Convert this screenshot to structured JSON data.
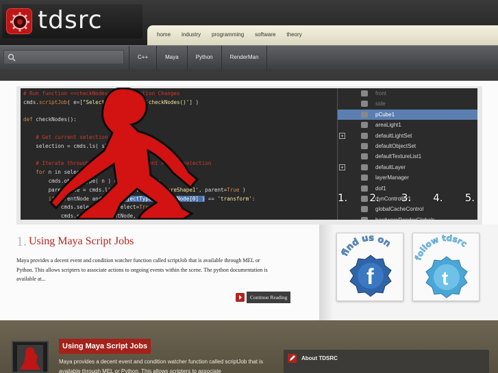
{
  "brand": {
    "name": "tdsrc"
  },
  "topnav": [
    "home",
    "industry",
    "programming",
    "software",
    "theory"
  ],
  "search": {
    "placeholder": ""
  },
  "subnav": [
    "C++",
    "Maya",
    "Python",
    "RenderMan"
  ],
  "code_lines": [
    {
      "c": "# Run function <<checkNodes>> on Selection Changes"
    },
    {
      "t": "cmds.",
      "k": "scriptJob",
      "t2": "( e=[",
      "s": "\"SelectionChanged\", 'checkNodes()'",
      "t3": "] )"
    },
    {
      "t": ""
    },
    {
      "k": "def",
      "t": " checkNodes():"
    },
    {
      "t": ""
    },
    {
      "c": "    # Get current selection"
    },
    {
      "t": "    selection = cmds.ls( sl=True )"
    },
    {
      "t": ""
    },
    {
      "c": "    # Iterate through selection, get parent > swap selection"
    },
    {
      "k": "    for",
      "t": " n in selection:"
    },
    {
      "t": "        cmds.objectType( n ) == ",
      "s": "'transform'",
      "t2": ":"
    },
    {
      "t": "        parentNode = cmds.listRelatives( ",
      "s": "'pSphereShape1'",
      "t2": ", parent=",
      "k": "True",
      "t3": " )"
    },
    {
      "k": "        if",
      "t": " parentNode and cmds.",
      "h": "objectType( parentNode[0] )",
      "t2": " == ",
      "s": "'transform'",
      "t3": ":"
    },
    {
      "t": "            cmds.select( n, deselect=",
      "k": "True",
      "t2": " )"
    },
    {
      "t": "            cmds.select( parentNode, add=",
      "k": "True",
      "t2": " )"
    }
  ],
  "outliner": [
    {
      "label": "front",
      "state": "dim"
    },
    {
      "label": "side",
      "state": "dim"
    },
    {
      "label": "pCube1",
      "state": "sel"
    },
    {
      "label": "areaLight1",
      "state": ""
    },
    {
      "label": "defaultLightSet",
      "state": "",
      "expand": true
    },
    {
      "label": "defaultObjectSet",
      "state": ""
    },
    {
      "label": "defaultTextureList1",
      "state": ""
    },
    {
      "label": "defaultLayer",
      "state": "",
      "expand": true
    },
    {
      "label": "layerManager",
      "state": ""
    },
    {
      "label": "dof1",
      "state": ""
    },
    {
      "label": "dynController1",
      "state": ""
    },
    {
      "label": "globalCacheControl",
      "state": ""
    },
    {
      "label": "hardwareRenderGlobals",
      "state": ""
    }
  ],
  "slide_numbers": [
    "1.",
    "2.",
    "3.",
    "4.",
    "5."
  ],
  "post": {
    "number": "1.",
    "title": "Using Maya Script Jobs",
    "excerpt": "Maya provides a decent event and condition watcher function called scriptJob that is available through MEL or Python. This allows scripters to associate actions to ongoing events within the scene. The python documentation is available at...",
    "continue_label": "Continue Reading"
  },
  "social": {
    "facebook_text": "find us on",
    "twitter_text": "follow tdsrc"
  },
  "footer": {
    "title": "Using Maya Script Jobs",
    "text": "Maya provides a decent event and condition watcher function called scriptJob that is available through MEL or Python. This allows scripters to associate",
    "about_title": "About TDSRC"
  },
  "colors": {
    "accent_red": "#b3231c",
    "selection_blue": "#5b7fb0"
  }
}
